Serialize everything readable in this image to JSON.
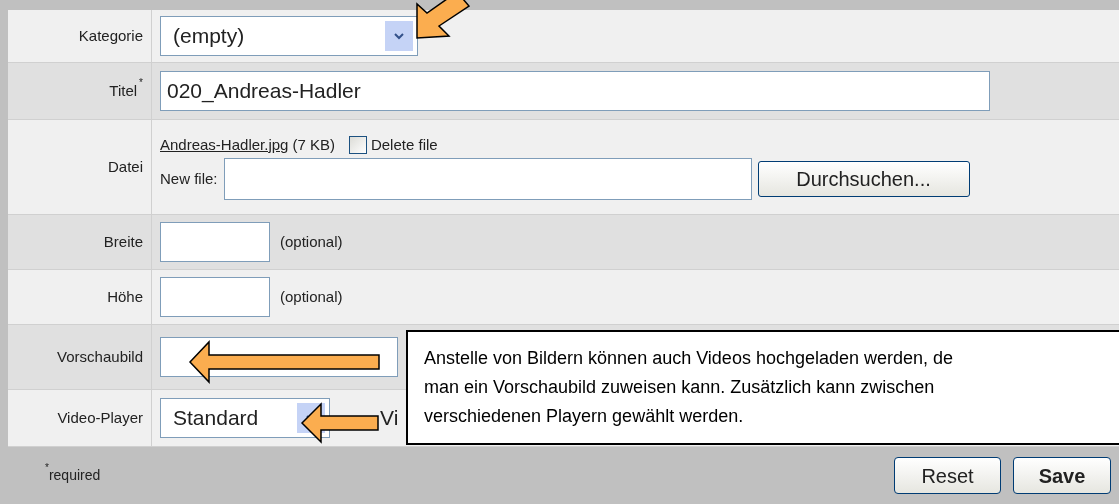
{
  "rows": [
    {
      "label": "Kategorie",
      "kind": "select",
      "value": "(empty)",
      "compact": false
    },
    {
      "label": "Titel",
      "mark": "*",
      "kind": "text",
      "value": "020_Andreas-Hadler"
    },
    {
      "label": "Datei",
      "kind": "file",
      "file_link": "Andreas-Hadler.jpg",
      "file_size": "(7 KB)",
      "delete_checked": false,
      "delete_label": "Delete file",
      "new_file_label": "New file:",
      "browse_button": "Durchsuchen..."
    },
    {
      "label": "Breite",
      "kind": "short",
      "note": "(optional)"
    },
    {
      "label": "Höhe",
      "kind": "short",
      "note": "(optional)"
    },
    {
      "label": "Vorschaubild",
      "kind": "text"
    },
    {
      "label": "Video-Player",
      "kind": "select",
      "value": "Standard",
      "compact": true,
      "note": "Vi"
    }
  ],
  "footer": {
    "mark": "*",
    "required_note": "required",
    "buttons": [
      {
        "label": "Reset",
        "primary": false
      },
      {
        "label": "Save",
        "primary": true
      }
    ]
  },
  "callout": {
    "lines": [
      "Anstelle von Bildern können auch Videos hochgeladen werden, de",
      "man ein Vorschaubild zuweisen kann. Zusätzlich kann zwischen",
      "verschiedenen Playern gewählt werden."
    ]
  }
}
